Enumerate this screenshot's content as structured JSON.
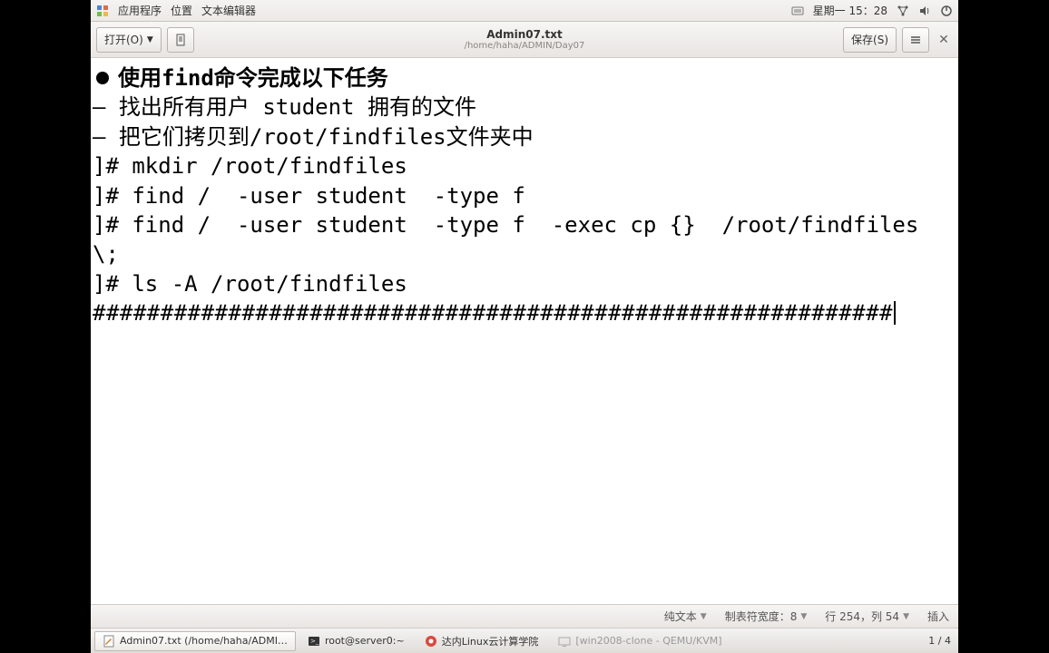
{
  "top_panel": {
    "apps_label": "应用程序",
    "places_label": "位置",
    "editor_label": "文本编辑器",
    "clock": "星期一 15：28"
  },
  "titlebar": {
    "open_label": "打开(O)",
    "save_label": "保存(S)",
    "title": "Admin07.txt",
    "subtitle": "/home/haha/ADMIN/Day07"
  },
  "editor": {
    "bullet_line": "使用find命令完成以下任务",
    "line2": "– 找出所有用户 student 拥有的文件",
    "line3": "– 把它们拷贝到/root/findfiles文件夹中",
    "blank": "",
    "line4": "]# mkdir /root/findfiles",
    "line5": "]# find /  -user student  -type f",
    "line6": "]# find /  -user student  -type f  -exec cp {}  /root/findfiles  \\;",
    "line7": "]# ls -A /root/findfiles",
    "hash_line": "###########################################################"
  },
  "statusbar": {
    "syntax": "纯文本",
    "tab_width": "制表符宽度：8",
    "cursor": "行 254，列 54",
    "mode": "插入"
  },
  "taskbar": {
    "items": [
      {
        "label": "Admin07.txt (/home/haha/ADMI…"
      },
      {
        "label": "root@server0:~"
      },
      {
        "label": "达内Linux云计算学院"
      },
      {
        "label": "[win2008-clone - QEMU/KVM]"
      }
    ],
    "pager": "1 / 4"
  }
}
